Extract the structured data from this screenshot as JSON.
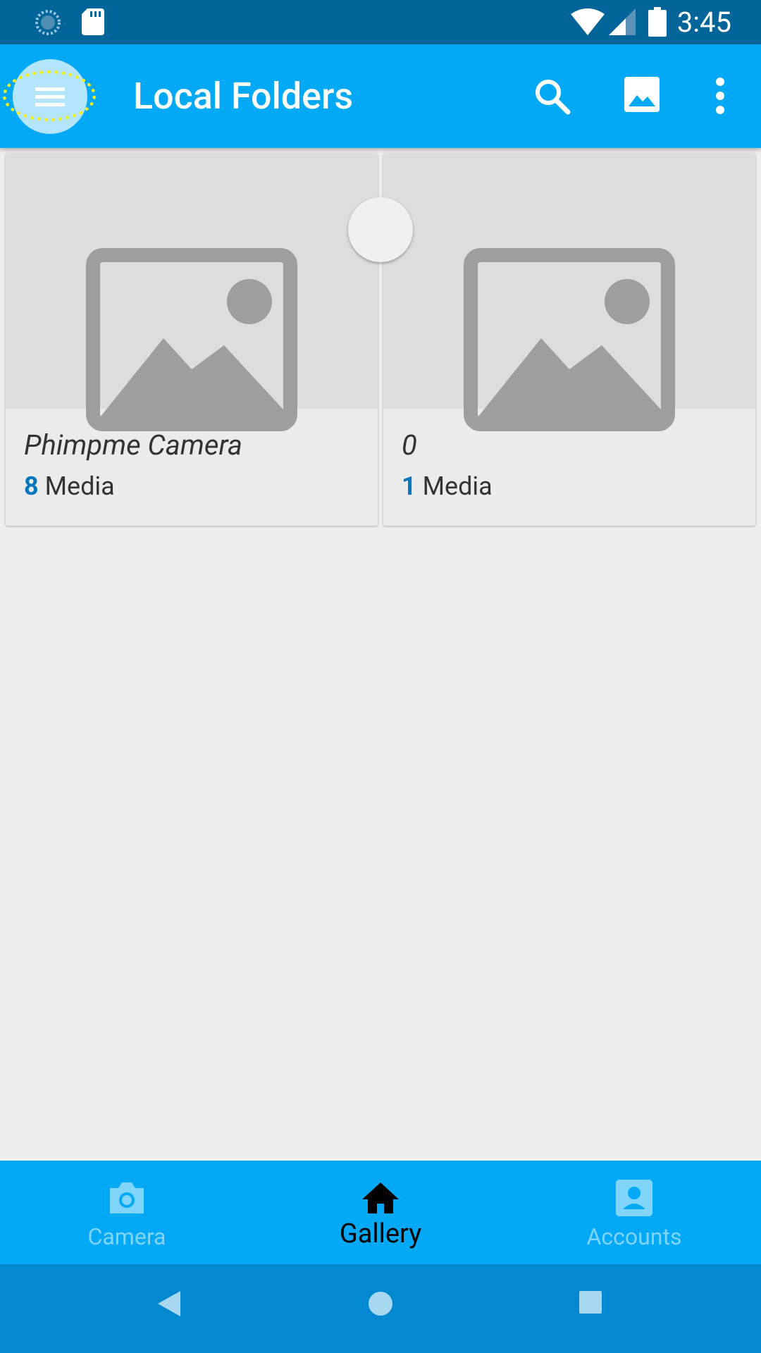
{
  "status_bar": {
    "time": "3:45",
    "icons": [
      "sync-icon",
      "sd-card-icon",
      "wifi-icon",
      "cell-signal-icon",
      "battery-icon"
    ]
  },
  "app_bar": {
    "title": "Local Folders",
    "actions": [
      "search-icon",
      "image-icon",
      "more-vert-icon"
    ]
  },
  "folders": [
    {
      "name": "Phimpme Camera",
      "count": "8",
      "count_suffix": "Media"
    },
    {
      "name": "0",
      "count": "1",
      "count_suffix": "Media"
    }
  ],
  "bottom_nav": {
    "items": [
      {
        "label": "Camera",
        "icon": "camera-icon"
      },
      {
        "label": "Gallery",
        "icon": "home-icon",
        "active": true
      },
      {
        "label": "Accounts",
        "icon": "account-box-icon"
      }
    ]
  },
  "colors": {
    "status_bar": "#02659a",
    "primary": "#03a9f4",
    "system_nav": "#0288d1",
    "count_accent": "#0277bd",
    "inactive_nav": "#81d4fa",
    "background": "#eeeeee"
  }
}
